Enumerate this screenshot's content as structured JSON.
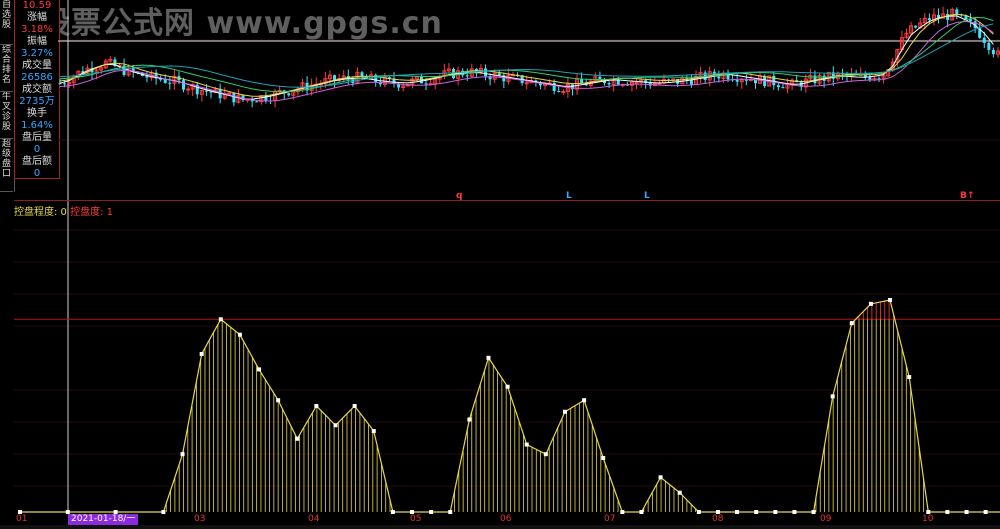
{
  "watermark": "股票公式网 www.gpgs.cn",
  "left_tabs": [
    "自选股",
    "综合排名",
    "牛叉诊股",
    "超级盘口"
  ],
  "info_panel": {
    "top_value": "10.59",
    "rows": [
      {
        "label": "涨幅",
        "value": "3.18%"
      },
      {
        "label": "振幅",
        "value": "3.27%"
      },
      {
        "label": "成交量",
        "value": "26586"
      },
      {
        "label": "成交额",
        "value": "2735万"
      },
      {
        "label": "换手",
        "value": "1.64%"
      },
      {
        "label": "盘后量",
        "value": "0"
      },
      {
        "label": "盘后额",
        "value": "0"
      }
    ]
  },
  "markers": [
    {
      "text": "q",
      "color": "#ff3b3b"
    },
    {
      "text": "L",
      "color": "#39a6ff"
    },
    {
      "text": "L",
      "color": "#39a6ff"
    },
    {
      "text": "B↑",
      "color": "#ff3b3b"
    }
  ],
  "indicator": {
    "name": "控盘程度: 0",
    "value_label": "控盘度: 1"
  },
  "crosshair_date": "2021-01-18/一",
  "x_axis_labels": [
    "01",
    "03",
    "04",
    "05",
    "06",
    "07",
    "08",
    "09",
    "10"
  ],
  "colors": {
    "bull": "#ff3b3b",
    "bear": "#39e6ff",
    "indicator": "#e6d84a",
    "threshold": "#b01818"
  },
  "chart_data": [
    {
      "type": "line",
      "title": "",
      "x": [
        0,
        5,
        10,
        15,
        20,
        25,
        30,
        35,
        40,
        45,
        50,
        55,
        60,
        65,
        70,
        75,
        80,
        85,
        90,
        95,
        100,
        105,
        110,
        115,
        120,
        125,
        130,
        135,
        140,
        145,
        150,
        155,
        160,
        165,
        170,
        175,
        180,
        185,
        190,
        195,
        200,
        205
      ],
      "series": [
        {
          "values": [
            55,
            62,
            66,
            61,
            58,
            56,
            52,
            49,
            46,
            48,
            51,
            54,
            57,
            58,
            56,
            55,
            57,
            60,
            61,
            59,
            57,
            55,
            53,
            55,
            57,
            56,
            55,
            56,
            58,
            60,
            58,
            56,
            54,
            57,
            59,
            58,
            60,
            82,
            90,
            92,
            85,
            70
          ]
        }
      ]
    },
    {
      "type": "area",
      "title": "",
      "y_threshold": 100,
      "x": [
        0,
        10,
        20,
        30,
        34,
        38,
        42,
        46,
        50,
        54,
        58,
        62,
        66,
        70,
        74,
        78,
        82,
        86,
        90,
        94,
        98,
        102,
        106,
        110,
        114,
        118,
        122,
        126,
        130,
        134,
        138,
        142,
        146,
        150,
        154,
        158,
        162,
        166,
        170,
        174,
        178,
        182,
        186,
        190,
        194,
        198,
        202
      ],
      "values": [
        0,
        0,
        0,
        0,
        30,
        82,
        100,
        92,
        74,
        58,
        38,
        55,
        45,
        55,
        42,
        0,
        0,
        0,
        0,
        48,
        80,
        65,
        35,
        30,
        52,
        58,
        28,
        0,
        0,
        18,
        10,
        0,
        0,
        0,
        0,
        0,
        0,
        0,
        60,
        98,
        108,
        110,
        70,
        0,
        0,
        0,
        0
      ]
    }
  ]
}
